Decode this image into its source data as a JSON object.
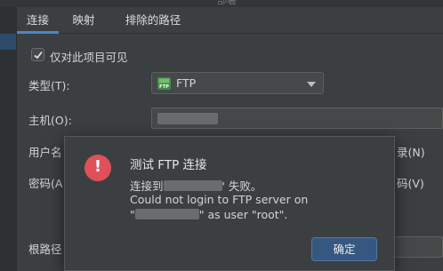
{
  "window": {
    "title": "部署"
  },
  "tabs": [
    {
      "label": "连接",
      "active": true
    },
    {
      "label": "映射",
      "active": false
    },
    {
      "label": "排除的路径",
      "active": false
    }
  ],
  "form": {
    "visible_only_label": "仅对此项目可见",
    "visible_only_checked": true,
    "type_label": "类型(T):",
    "type_value": "FTP",
    "host_label": "主机(O):",
    "user_label": "用户名",
    "password_label": "密码(A",
    "root_label": "根路径",
    "right_label_1": "录(N)",
    "right_label_2": "码(V)"
  },
  "dialog": {
    "title": "测试 FTP 连接",
    "message_line1_prefix": "连接到",
    "message_line1_suffix": "' 失败。",
    "message_line2": "Could not login to FTP server on",
    "message_line3_prefix": "\"",
    "message_line3_suffix": "\" as user \"root\".",
    "ok_label": "确定",
    "icon": "error-icon"
  },
  "colors": {
    "accent": "#4a88c7",
    "error": "#e0505a",
    "button": "#365880"
  }
}
